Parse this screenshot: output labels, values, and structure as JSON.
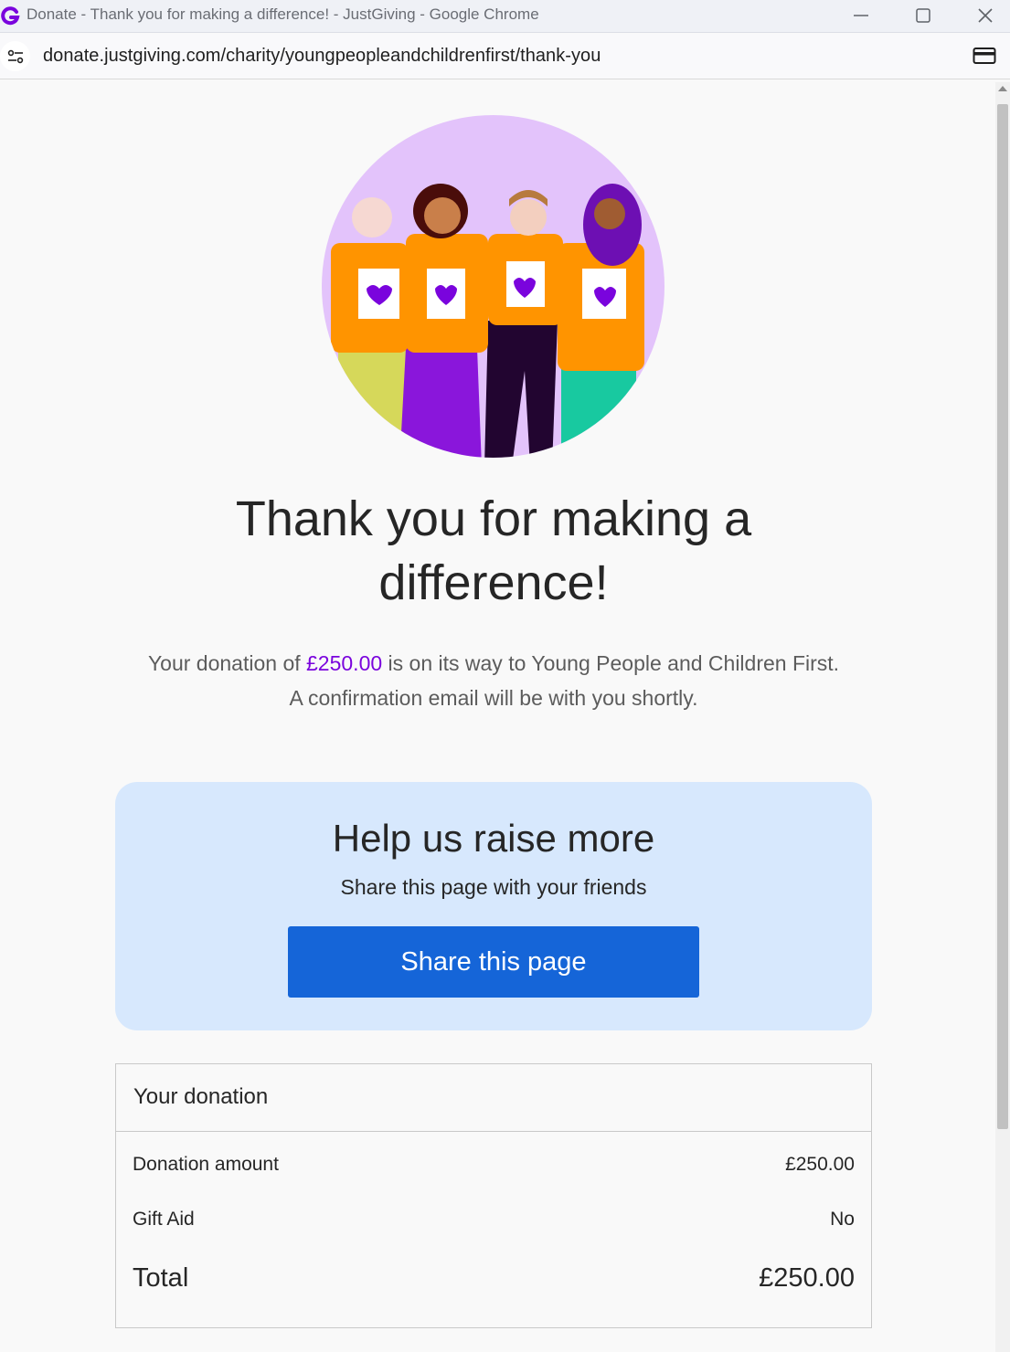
{
  "browser": {
    "window_title": "Donate - Thank you for making a difference! - JustGiving - Google Chrome",
    "url": "donate.justgiving.com/charity/youngpeopleandchildrenfirst/thank-you"
  },
  "page": {
    "headline": "Thank you for making a difference!",
    "message_prefix": "Your donation of ",
    "message_amount": "£250.00",
    "message_suffix": " is on its way to Young People and Children First.",
    "message_line2": "A confirmation email will be with you shortly."
  },
  "share": {
    "title": "Help us raise more",
    "subtitle": "Share this page with your friends",
    "button_label": "Share this page"
  },
  "donation": {
    "heading": "Your donation",
    "rows": [
      {
        "label": "Donation amount",
        "value": "£250.00"
      },
      {
        "label": "Gift Aid",
        "value": "No"
      },
      {
        "label": "Total",
        "value": "£250.00"
      }
    ]
  },
  "colors": {
    "accent_purple": "#7a04dd",
    "share_button": "#1565d8",
    "share_box_bg": "#d7e8fd"
  }
}
